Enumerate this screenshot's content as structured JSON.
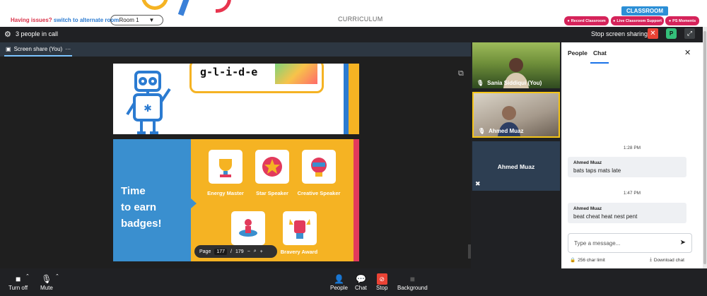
{
  "top": {
    "issue_red": "Having issues?",
    "issue_link": "switch to alternate room",
    "room_value": "Room 1",
    "section_title": "CURRICULUM",
    "classroom_tab": "CLASSROOM",
    "pills": [
      "Record Classroom",
      "Live Classroom Support",
      "PS Moments"
    ]
  },
  "meet": {
    "people_count": "3 people in call",
    "stop_sharing": "Stop screen sharing",
    "p_badge": "P"
  },
  "share": {
    "label": "Screen share (You)",
    "more": "···"
  },
  "slide": {
    "word": "g-l-i-d-e",
    "headline_lines": [
      "Time",
      "to earn",
      "badges!"
    ],
    "badges": [
      "Energy Master",
      "Star Speaker",
      "Creative Speaker",
      "",
      "Bravery Award"
    ]
  },
  "pager": {
    "label": "Page",
    "current": "177",
    "total": "179"
  },
  "tiles": {
    "t1": "Sania Siddiqui (You)",
    "t2": "Ahmed Muaz",
    "t3": "Ahmed Muaz"
  },
  "sidebar": {
    "tab_people": "People",
    "tab_chat": "Chat",
    "messages": [
      {
        "time": "1:28 PM",
        "sender": "Ahmed Muaz",
        "text": "bats taps mats late"
      },
      {
        "time": "1:47 PM",
        "sender": "Ahmed Muaz",
        "text": "beat cheat heat nest pent"
      }
    ],
    "placeholder": "Type a message...",
    "char_limit": "256 char limit",
    "download": "Download chat"
  },
  "controls": {
    "turn_off": "Turn off",
    "mute": "Mute",
    "people": "People",
    "chat": "Chat",
    "stop": "Stop",
    "background": "Background"
  },
  "colors": {
    "accent_red": "#d5235a",
    "classroom_blue": "#2c8fd6",
    "slide_yellow": "#f5b323",
    "slide_blue": "#3a8fcf"
  }
}
